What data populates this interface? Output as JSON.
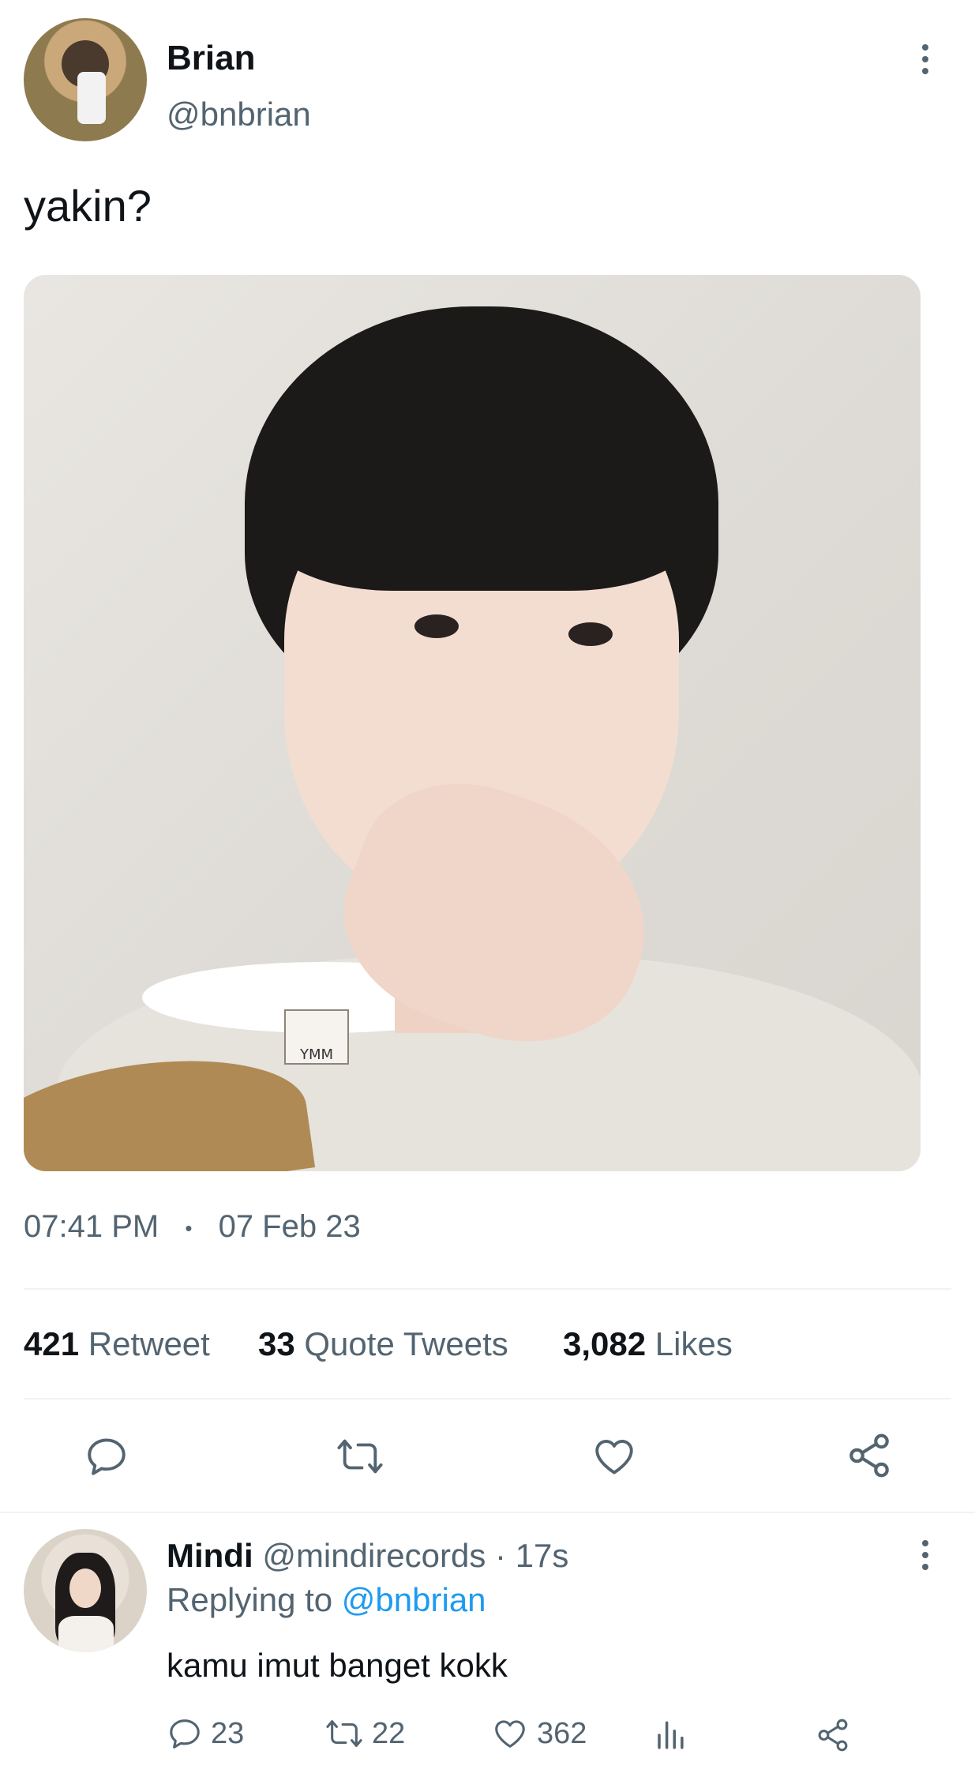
{
  "tweet": {
    "author": {
      "name": "Brian",
      "handle": "@bnbrian"
    },
    "text": "yakin?",
    "time": "07:41 PM",
    "separator": "•",
    "date": "07 Feb 23",
    "photo_tag_text": "YMM",
    "stats": [
      {
        "count": "421",
        "label": "Retweet"
      },
      {
        "count": "33",
        "label": "Quote Tweets"
      },
      {
        "count": "3,082",
        "label": "Likes"
      }
    ],
    "actions": [
      {
        "icon": "reply-icon"
      },
      {
        "icon": "retweet-icon"
      },
      {
        "icon": "like-icon"
      },
      {
        "icon": "share-icon"
      }
    ]
  },
  "reply": {
    "name": "Mindi",
    "handle": "@mindirecords",
    "age": "· 17s",
    "replying_prefix": "Replying to",
    "replying_handle": "@bnbrian",
    "text": "kamu imut banget kokk",
    "counts": {
      "replies": "23",
      "retweets": "22",
      "likes": "362"
    }
  },
  "colors": {
    "accent": "#1d9bf0",
    "muted": "#536471",
    "text": "#0f1419"
  }
}
